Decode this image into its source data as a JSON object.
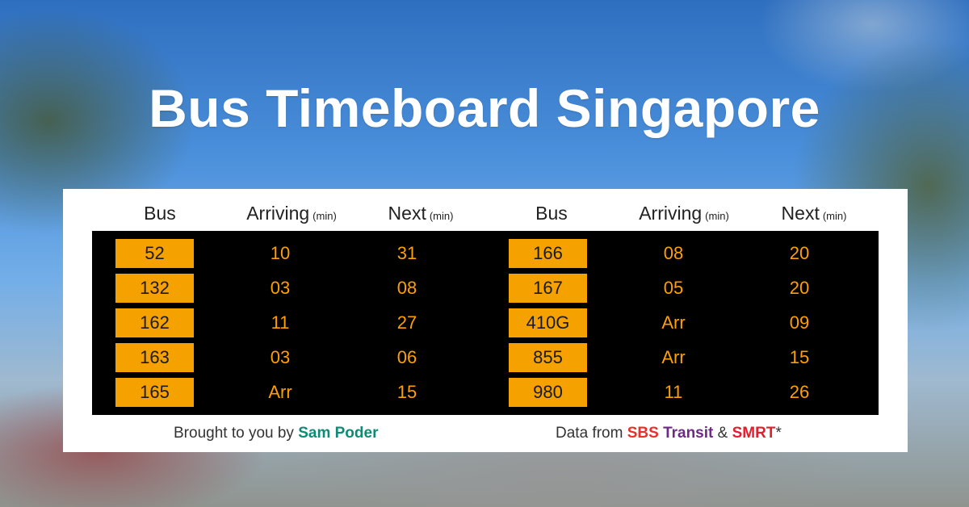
{
  "title": "Bus Timeboard Singapore",
  "headers": {
    "bus": "Bus",
    "arriving": "Arriving",
    "next": "Next",
    "unit": "(min)"
  },
  "left_rows": [
    {
      "bus": "52",
      "arriving": "10",
      "next": "31"
    },
    {
      "bus": "132",
      "arriving": "03",
      "next": "08"
    },
    {
      "bus": "162",
      "arriving": "11",
      "next": "27"
    },
    {
      "bus": "163",
      "arriving": "03",
      "next": "06"
    },
    {
      "bus": "165",
      "arriving": "Arr",
      "next": "15"
    }
  ],
  "right_rows": [
    {
      "bus": "166",
      "arriving": "08",
      "next": "20"
    },
    {
      "bus": "167",
      "arriving": "05",
      "next": "20"
    },
    {
      "bus": "410G",
      "arriving": "Arr",
      "next": "09"
    },
    {
      "bus": "855",
      "arriving": "Arr",
      "next": "15"
    },
    {
      "bus": "980",
      "arriving": "11",
      "next": "26"
    }
  ],
  "footer": {
    "credit_prefix": "Brought to you by ",
    "credit_name": "Sam Poder",
    "data_prefix": "Data from ",
    "sbs": "SBS",
    "transit": "Transit",
    "amp": "&",
    "smrt": "SMRT",
    "asterisk": "*"
  },
  "colors": {
    "bus_box": "#f5a200",
    "board_text": "#ff9f00",
    "board_bg": "#000000",
    "credit_name": "#108a76",
    "sbs": "#e8312a",
    "transit": "#6d2b86",
    "smrt": "#e0202e"
  }
}
